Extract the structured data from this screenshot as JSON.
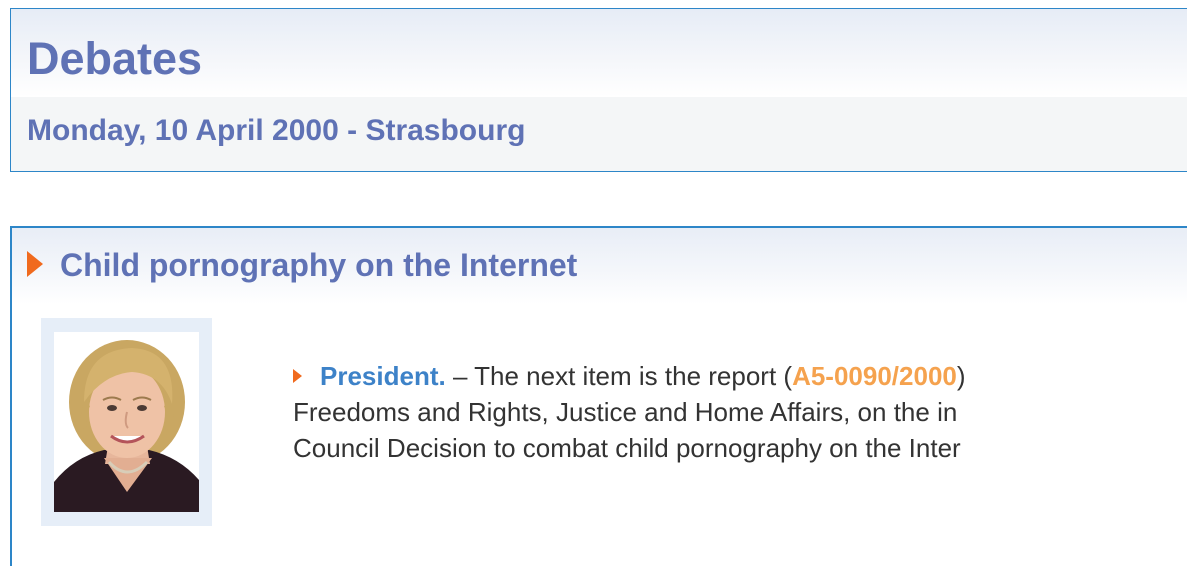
{
  "header": {
    "title": "Debates",
    "session": "Monday, 10 April 2000 - Strasbourg"
  },
  "item": {
    "title": "Child pornography on the Internet",
    "icons": {
      "title_bullet": "orange-triangle-arrow-icon",
      "speech_bullet": "orange-triangle-arrow-icon"
    },
    "speech": {
      "speaker": "President.",
      "line1_before_ref": " – The next item is the report (",
      "doc_ref": "A5-0090/2000",
      "line1_after_ref": ")",
      "line2": "Freedoms and Rights, Justice and Home Affairs, on the in",
      "line3": "Council Decision to combat child pornography on the Inter"
    }
  },
  "colors": {
    "heading": "#5f72b5",
    "border": "#2d86c8",
    "arrow": "#f06a1e",
    "speaker": "#3d82c8",
    "doc_ref": "#f5a24e",
    "body_text": "#333333"
  }
}
